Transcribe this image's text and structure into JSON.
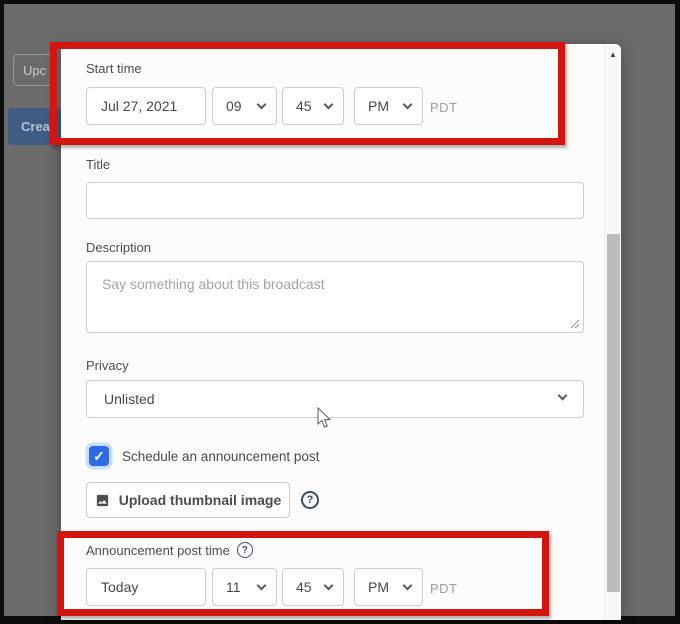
{
  "background": {
    "tab_label": "Upc",
    "create_button_label": "Crea"
  },
  "modal": {
    "start_time": {
      "label": "Start time",
      "date_value": "Jul 27, 2021",
      "hour_value": "09",
      "minute_value": "45",
      "meridiem_value": "PM",
      "timezone": "PDT"
    },
    "title_field": {
      "label": "Title",
      "value": ""
    },
    "description_field": {
      "label": "Description",
      "placeholder": "Say something about this broadcast",
      "value": ""
    },
    "privacy": {
      "label": "Privacy",
      "selected": "Unlisted"
    },
    "announcement_checkbox": {
      "label": "Schedule an announcement post",
      "checked": true
    },
    "upload": {
      "button_label": "Upload thumbnail image"
    },
    "announcement_post_time": {
      "label": "Announcement post time",
      "date_value": "Today",
      "hour_value": "11",
      "minute_value": "45",
      "meridiem_value": "PM",
      "timezone": "PDT"
    }
  },
  "icons": {
    "checkbox_check": "✓",
    "help_glyph": "?",
    "scroll_up": "▲"
  },
  "colors": {
    "highlight_red": "#d2150e",
    "checkbox_blue": "#2c6be3",
    "overlay_gray": "#6b6b6b",
    "create_button_blue": "#3f5c82"
  }
}
